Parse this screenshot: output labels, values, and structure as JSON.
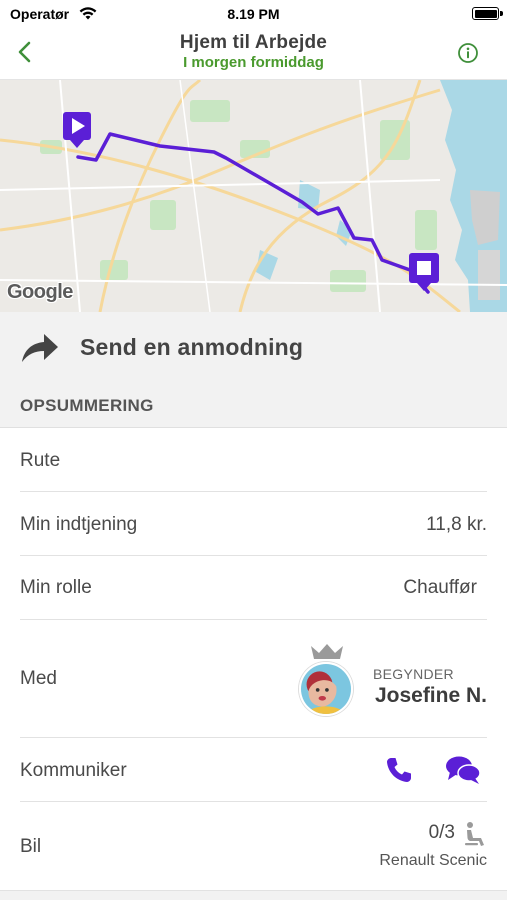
{
  "status_bar": {
    "carrier": "Operatør",
    "time": "8.19 PM"
  },
  "nav": {
    "title": "Hjem til Arbejde",
    "subtitle": "I morgen formiddag",
    "back_icon": "chevron-left-icon",
    "info_icon": "info-circle-icon"
  },
  "map": {
    "attribution": "Google",
    "start_marker": "play-marker-icon",
    "end_marker": "stop-marker-icon"
  },
  "send_request": {
    "icon": "share-arrow-icon",
    "label": "Send en anmodning"
  },
  "summary": {
    "header": "OPSUMMERING",
    "route_label": "Rute",
    "earnings_label": "Min indtjening",
    "earnings_value": "11,8 kr.",
    "role_label": "Min rolle",
    "role_value": "Chauffør",
    "with_label": "Med",
    "partner_level": "BEGYNDER",
    "partner_name": "Josefine N.",
    "communicate_label": "Kommuniker",
    "car_label": "Bil",
    "seats_value": "0/3",
    "car_model": "Renault Scenic"
  },
  "colors": {
    "accent_purple": "#5b1fd6",
    "accent_green": "#4a9a2e",
    "nav_green": "#3f8f3a"
  }
}
